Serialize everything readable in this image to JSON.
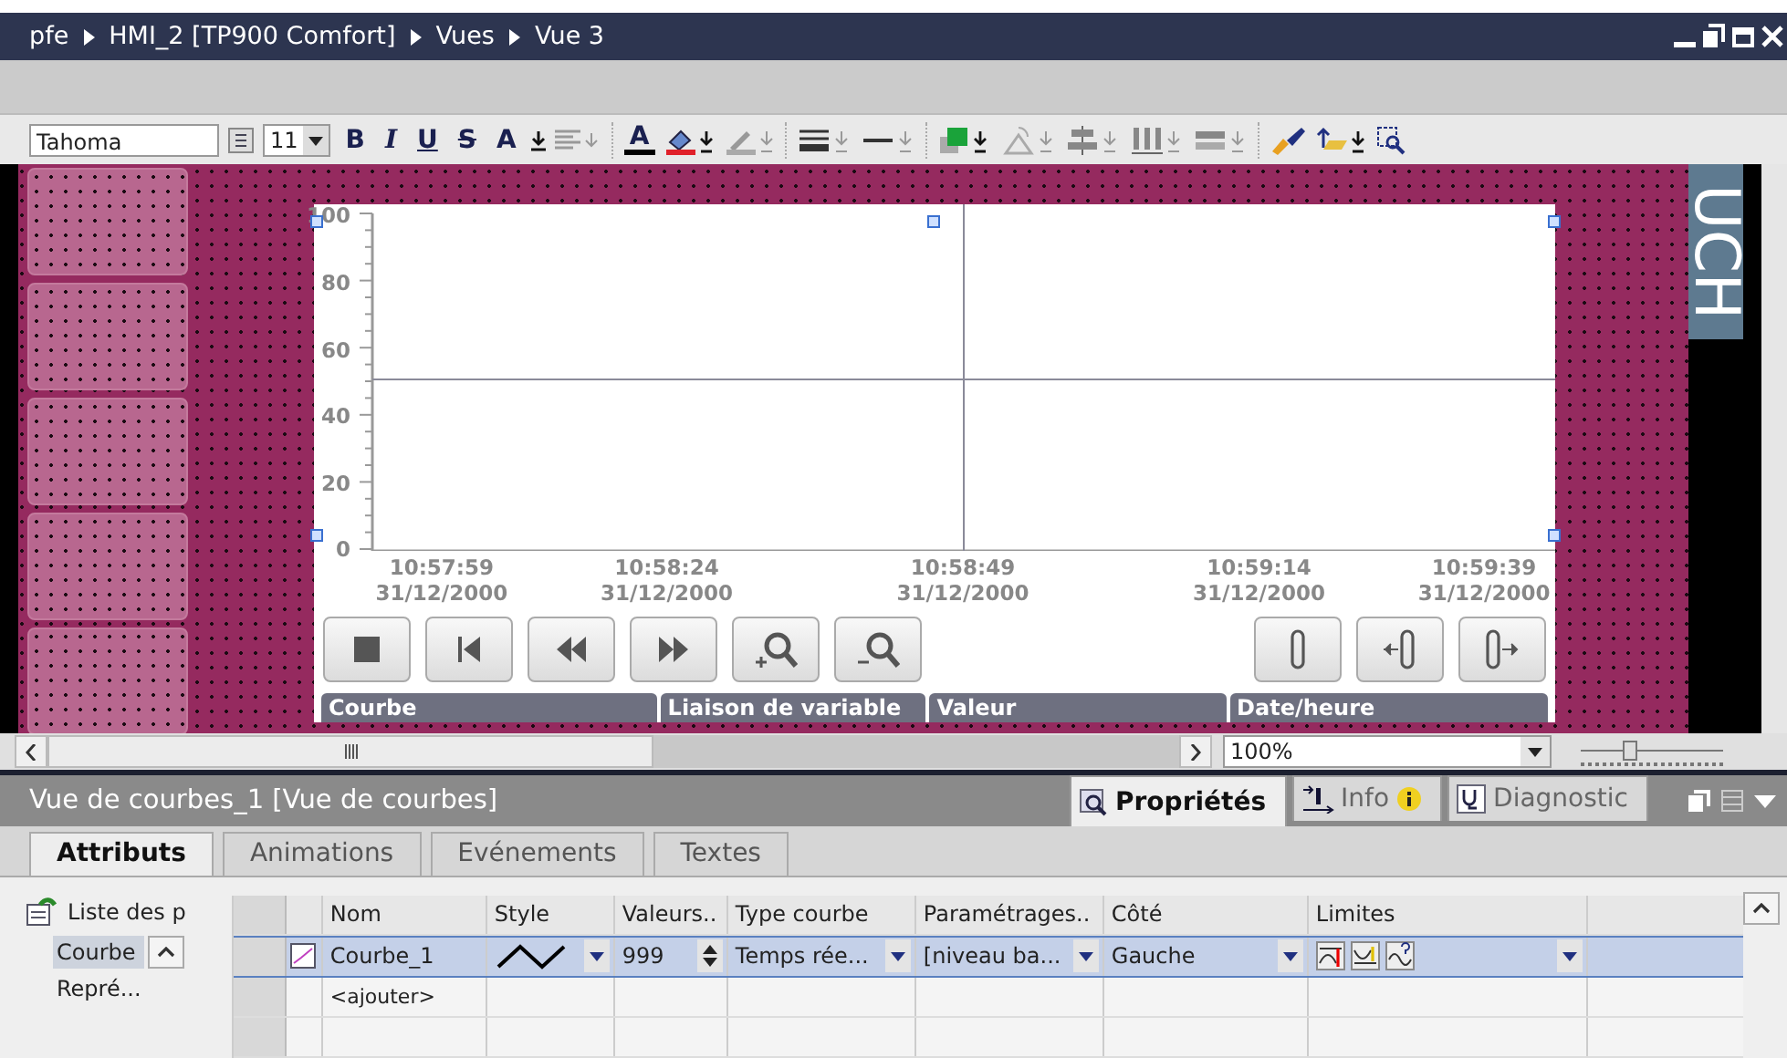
{
  "title_bar": {
    "breadcrumb": [
      "pfe",
      "HMI_2 [TP900 Comfort]",
      "Vues",
      "Vue 3"
    ]
  },
  "toolbar": {
    "font": "Tahoma",
    "size": "11",
    "format_buttons": [
      {
        "label": "B",
        "kind": "bold"
      },
      {
        "label": "I",
        "kind": "italic"
      },
      {
        "label": "U",
        "kind": "underline"
      },
      {
        "label": "S",
        "kind": "strike"
      }
    ],
    "grow_label": "A",
    "text_color_label": "A"
  },
  "canvas": {
    "side_text": "UCH",
    "trend": {
      "y_labels": [
        "100",
        "80",
        "60",
        "40",
        "20",
        "0"
      ],
      "x_labels": [
        {
          "time": "10:57:59",
          "date": "31/12/2000"
        },
        {
          "time": "10:58:24",
          "date": "31/12/2000"
        },
        {
          "time": "10:58:49",
          "date": "31/12/2000"
        },
        {
          "time": "10:59:14",
          "date": "31/12/2000"
        },
        {
          "time": "10:59:39",
          "date": "31/12/2000"
        }
      ],
      "table_columns": [
        "Courbe",
        "Liaison de variable",
        "Valeur",
        "Date/heure"
      ]
    }
  },
  "zoom": {
    "value": "100%",
    "level": 0.35
  },
  "inspector": {
    "title": "Vue de courbes_1 [Vue de courbes]",
    "tabs": [
      {
        "label": "Propriétés",
        "selected": true
      },
      {
        "label": "Info",
        "selected": false
      },
      {
        "label": "Diagnostic",
        "selected": false
      }
    ],
    "subtabs": [
      {
        "label": "Attributs",
        "selected": true
      },
      {
        "label": "Animations",
        "selected": false
      },
      {
        "label": "Evénements",
        "selected": false
      },
      {
        "label": "Textes",
        "selected": false
      }
    ],
    "nav": {
      "header": "Liste des p",
      "items": [
        {
          "label": "Courbe",
          "selected": true
        },
        {
          "label": "Repré...",
          "selected": false
        }
      ]
    },
    "table": {
      "columns": [
        "Nom",
        "Style",
        "Valeurs..",
        "Type courbe",
        "Paramétrages..",
        "Côté",
        "Limites"
      ],
      "rows": [
        {
          "kind": "curve",
          "selected": true,
          "name": "Courbe_1",
          "values": "999",
          "type": "Temps rée...",
          "settings": "[niveau ba...",
          "side": "Gauche"
        },
        {
          "kind": "add",
          "selected": false,
          "name": "<ajouter>"
        }
      ]
    }
  }
}
